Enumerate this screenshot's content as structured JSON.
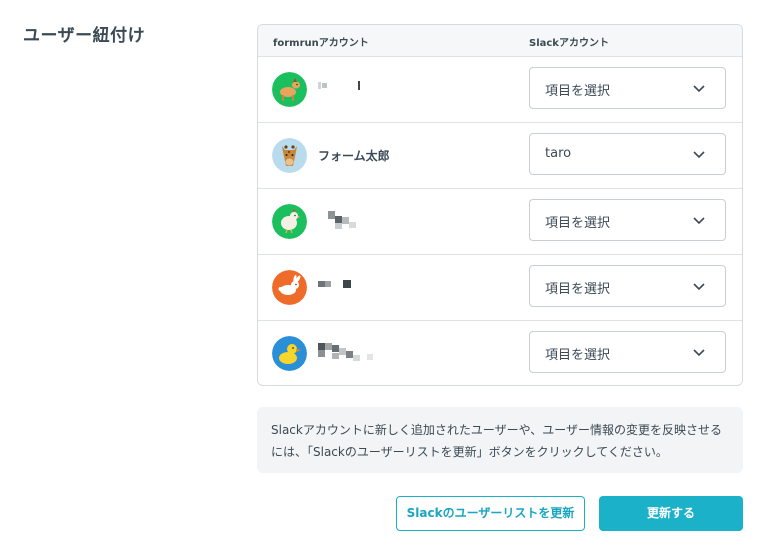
{
  "section": {
    "title": "ユーザー紐付け"
  },
  "table": {
    "headers": {
      "formrun": "formrunアカウント",
      "slack": "Slackアカウント"
    },
    "rows": [
      {
        "avatar_icon": "horse-icon",
        "avatar_color": "#1cbf5e",
        "name": "",
        "name_redacted": true,
        "select_value": "項目を選択"
      },
      {
        "avatar_icon": "giraffe-icon",
        "avatar_color": "#b9dbee",
        "name": "フォーム太郎",
        "name_redacted": false,
        "select_value": "taro"
      },
      {
        "avatar_icon": "chicken-icon",
        "avatar_color": "#1cbf5e",
        "name": "",
        "name_redacted": true,
        "select_value": "項目を選択"
      },
      {
        "avatar_icon": "rabbit-icon",
        "avatar_color": "#ef6b2a",
        "name": "",
        "name_redacted": true,
        "select_value": "項目を選択"
      },
      {
        "avatar_icon": "duck-icon",
        "avatar_color": "#2a8fd6",
        "name": "",
        "name_redacted": true,
        "select_value": "項目を選択"
      }
    ]
  },
  "note": {
    "text": "Slackアカウントに新しく追加されたユーザーや、ユーザー情報の変更を反映させるには、「Slackのユーザーリストを更新」ボタンをクリックしてください。"
  },
  "buttons": {
    "refresh_label": "Slackのユーザーリストを更新",
    "update_label": "更新する"
  },
  "colors": {
    "accent": "#1ab1c9",
    "text": "#3b4a55",
    "border": "#d6dbde",
    "note_bg": "#f3f4f6"
  }
}
